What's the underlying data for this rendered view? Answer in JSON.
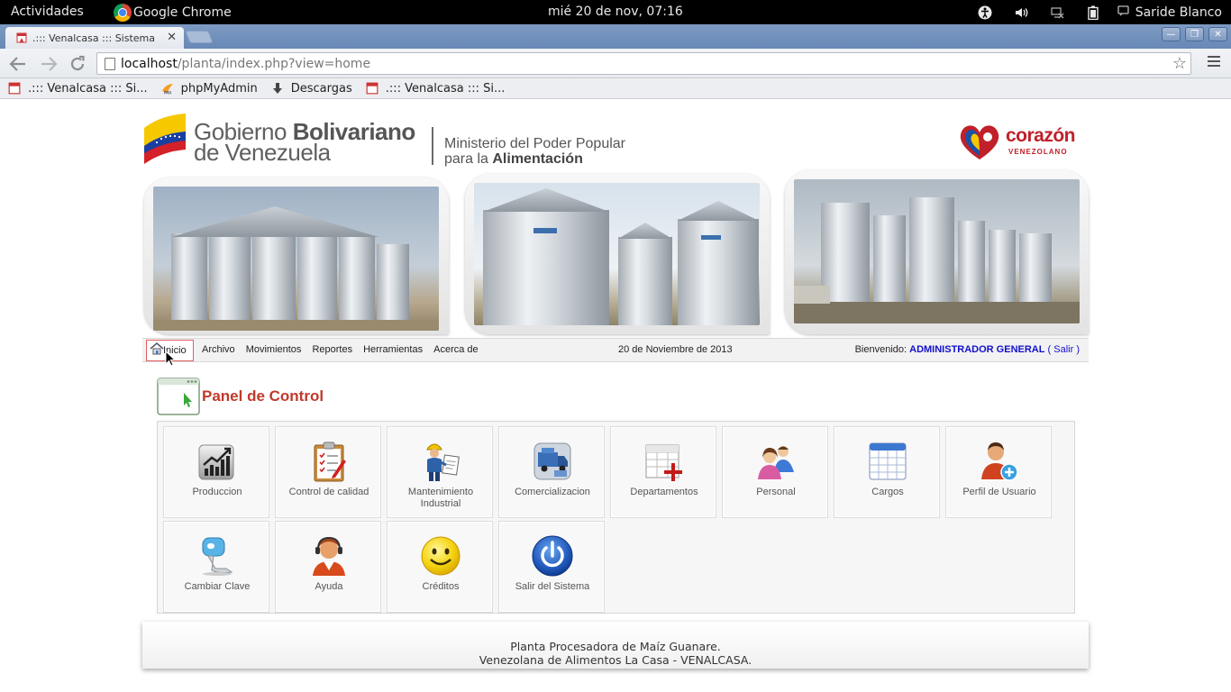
{
  "system_bar": {
    "activities": "Actividades",
    "app_name": "Google Chrome",
    "clock": "mié 20 de nov, 07:16",
    "user": "Saride Blanco",
    "icons": [
      "accessibility-icon",
      "volume-icon",
      "network-icon",
      "battery-icon"
    ]
  },
  "browser": {
    "tab_title": ".::: Venalcasa ::: Sistema de",
    "url_host": "localhost",
    "url_path": "/planta/index.php?view=home",
    "bookmarks": [
      {
        "label": ".::: Venalcasa ::: Si...",
        "icon": "venalcasa-favicon"
      },
      {
        "label": "phpMyAdmin",
        "icon": "phpmyadmin-icon"
      },
      {
        "label": "Descargas",
        "icon": "download-icon"
      },
      {
        "label": ".::: Venalcasa ::: Si...",
        "icon": "venalcasa-favicon"
      }
    ]
  },
  "header": {
    "gov_line1_a": "Gobierno ",
    "gov_line1_b": "Bolivariano",
    "gov_line2": "de Venezuela",
    "ministry_line1": "Ministerio del Poder Popular",
    "ministry_line2_a": "para la ",
    "ministry_line2_b": "Alimentación",
    "brand_word": "corazón",
    "brand_sub": "VENEZOLANO"
  },
  "menu": {
    "home": "Inicio",
    "items": [
      "Archivo",
      "Movimientos",
      "Reportes",
      "Herramientas",
      "Acerca de"
    ],
    "date": "20 de Noviembre de 2013",
    "welcome_label": "Bienvenido: ",
    "user": "ADMINISTRADOR GENERAL",
    "open_paren": " ( ",
    "logout": "Salir",
    "close_paren": " )"
  },
  "panel": {
    "title": "Panel de Control",
    "tiles": [
      {
        "label": "Produccion",
        "icon": "production-chart-icon"
      },
      {
        "label": "Control de calidad",
        "icon": "clipboard-icon"
      },
      {
        "label": "Mantenimiento Industrial",
        "icon": "worker-icon"
      },
      {
        "label": "Comercializacion",
        "icon": "delivery-truck-icon"
      },
      {
        "label": "Departamentos",
        "icon": "spreadsheet-add-icon"
      },
      {
        "label": "Personal",
        "icon": "people-icon"
      },
      {
        "label": "Cargos",
        "icon": "table-icon"
      },
      {
        "label": "Perfil de Usuario",
        "icon": "user-add-icon"
      },
      {
        "label": "Cambiar Clave",
        "icon": "key-icon"
      },
      {
        "label": "Ayuda",
        "icon": "support-agent-icon"
      },
      {
        "label": "Créditos",
        "icon": "smiley-icon"
      },
      {
        "label": "Salir del Sistema",
        "icon": "power-icon"
      }
    ]
  },
  "footer": {
    "line1": "Planta Procesadora de Maíz Guanare.",
    "line2": "Venezolana de Alimentos La Casa - VENALCASA."
  }
}
